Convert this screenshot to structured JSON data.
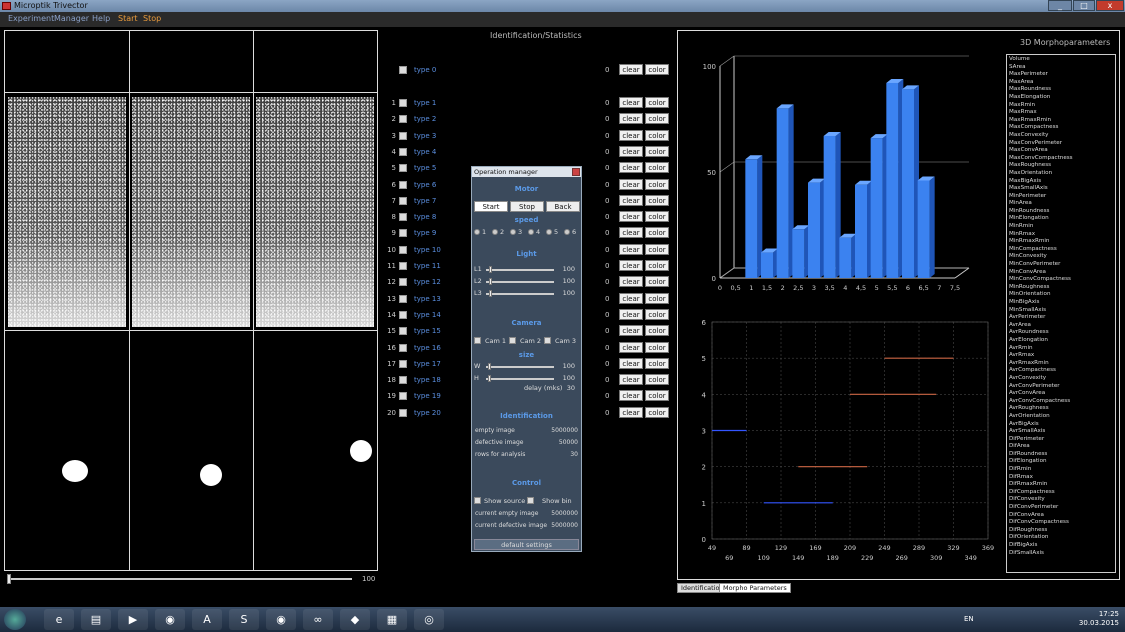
{
  "app": {
    "title": "Microptik Trivector",
    "menu": [
      {
        "label": "Experiment",
        "accent": false
      },
      {
        "label": "Manager",
        "accent": false
      },
      {
        "label": "Help",
        "accent": false
      },
      {
        "label": "Start",
        "accent": true
      },
      {
        "label": "Stop",
        "accent": true
      }
    ]
  },
  "window_buttons": [
    "_",
    "□",
    "x"
  ],
  "left": {
    "slider_value": "100"
  },
  "identification": {
    "title": "Identification/Statistics",
    "type0": {
      "label": "type 0",
      "count": "0"
    },
    "clear_label": "clear",
    "color_label": "color",
    "types": [
      {
        "num": "1",
        "label": "type 1",
        "count": "0"
      },
      {
        "num": "2",
        "label": "type 2",
        "count": "0"
      },
      {
        "num": "3",
        "label": "type 3",
        "count": "0"
      },
      {
        "num": "4",
        "label": "type 4",
        "count": "0"
      },
      {
        "num": "5",
        "label": "type 5",
        "count": "0"
      },
      {
        "num": "6",
        "label": "type 6",
        "count": "0"
      },
      {
        "num": "7",
        "label": "type 7",
        "count": "0"
      },
      {
        "num": "8",
        "label": "type 8",
        "count": "0"
      },
      {
        "num": "9",
        "label": "type 9",
        "count": "0"
      },
      {
        "num": "10",
        "label": "type 10",
        "count": "0"
      },
      {
        "num": "11",
        "label": "type 11",
        "count": "0"
      },
      {
        "num": "12",
        "label": "type 12",
        "count": "0"
      },
      {
        "num": "13",
        "label": "type 13",
        "count": "0"
      },
      {
        "num": "14",
        "label": "type 14",
        "count": "0"
      },
      {
        "num": "15",
        "label": "type 15",
        "count": "0"
      },
      {
        "num": "16",
        "label": "type 16",
        "count": "0"
      },
      {
        "num": "17",
        "label": "type 17",
        "count": "0"
      },
      {
        "num": "18",
        "label": "type 18",
        "count": "0"
      },
      {
        "num": "19",
        "label": "type 19",
        "count": "0"
      },
      {
        "num": "20",
        "label": "type 20",
        "count": "0"
      }
    ]
  },
  "opmanager": {
    "title": "Operation manager",
    "motor": "Motor",
    "start": "Start",
    "stop": "Stop",
    "back": "Back",
    "speed": "speed",
    "speeds": [
      "1",
      "2",
      "3",
      "4",
      "5",
      "6"
    ],
    "light": "Light",
    "lights": [
      {
        "l": "L1",
        "v": "100"
      },
      {
        "l": "L2",
        "v": "100"
      },
      {
        "l": "L3",
        "v": "100"
      }
    ],
    "camera": "Camera",
    "cams": [
      "Cam 1",
      "Cam 2",
      "Cam 3"
    ],
    "size": "size",
    "sizes": [
      {
        "l": "W",
        "v": "100"
      },
      {
        "l": "H",
        "v": "100"
      }
    ],
    "delay_label": "delay (mks)",
    "delay": "30",
    "ident": "Identification",
    "ident_kv": [
      {
        "k": "empty image",
        "v": "5000000"
      },
      {
        "k": "defective image",
        "v": "50000"
      },
      {
        "k": "rows for analysis",
        "v": "30"
      }
    ],
    "control": "Control",
    "show_source": "Show source",
    "show_bin": "Show bin",
    "control_kv": [
      {
        "k": "current empty image",
        "v": "5000000"
      },
      {
        "k": "current defective image",
        "v": "5000000"
      }
    ],
    "default": "default settings"
  },
  "morpho": {
    "title": "3D Morphoparameters",
    "params": [
      "Volume",
      "SArea",
      "MaxPerimeter",
      "MaxArea",
      "MaxRoundness",
      "MaxElongation",
      "MaxRmin",
      "MaxRmax",
      "MaxRmaxRmin",
      "MaxCompactness",
      "MaxConvexity",
      "MaxConvPerimeter",
      "MaxConvArea",
      "MaxConvCompactness",
      "MaxRoughness",
      "MaxOrientation",
      "MaxBigAxis",
      "MaxSmallAxis",
      "MinPerimeter",
      "MinArea",
      "MinRoundness",
      "MinElongation",
      "MinRmin",
      "MinRmax",
      "MinRmaxRmin",
      "MinCompactness",
      "MinConvexity",
      "MinConvPerimeter",
      "MinConvArea",
      "MinConvCompactness",
      "MinRoughness",
      "MinOrientation",
      "MinBigAxis",
      "MinSmallAxis",
      "AvrPerimeter",
      "AvrArea",
      "AvrRoundness",
      "AvrElongation",
      "AvrRmin",
      "AvrRmax",
      "AvrRmaxRmin",
      "AvrCompactness",
      "AvrConvexity",
      "AvrConvPerimeter",
      "AvrConvArea",
      "AvrConvCompactness",
      "AvrRoughness",
      "AvrOrientation",
      "AvrBigAxis",
      "AvrSmallAxis",
      "DifPerimeter",
      "DifArea",
      "DifRoundness",
      "DifElongation",
      "DifRmin",
      "DifRmax",
      "DifRmaxRmin",
      "DifCompactness",
      "DifConvexity",
      "DifConvPerimeter",
      "DifConvArea",
      "DifConvCompactness",
      "DifRoughness",
      "DifOrientation",
      "DifBigAxis",
      "DifSmallAxis"
    ],
    "tabs": [
      "Identification",
      "Morpho Parameters"
    ]
  },
  "chart_data": [
    {
      "type": "bar",
      "x": [
        1,
        1.5,
        2,
        2.5,
        3,
        3.5,
        4,
        4.5,
        5,
        5.5,
        6,
        6.5
      ],
      "values": [
        56,
        12,
        80,
        23,
        45,
        67,
        19,
        44,
        66,
        92,
        89,
        46
      ],
      "xticks": [
        "0",
        "0,5",
        "1",
        "1,5",
        "2",
        "2,5",
        "3",
        "3,5",
        "4",
        "4,5",
        "5",
        "5,5",
        "6",
        "6,5",
        "7",
        "7,5"
      ],
      "yticks": [
        "0",
        "50",
        "100"
      ],
      "ylim": [
        0,
        100
      ],
      "color": "#3b82f0"
    },
    {
      "type": "line",
      "yticks": [
        "0",
        "1",
        "2",
        "3",
        "4",
        "5",
        "6"
      ],
      "xticks_top": [
        "49",
        "89",
        "129",
        "169",
        "209",
        "249",
        "289",
        "329",
        "369"
      ],
      "xticks_bottom": [
        "69",
        "109",
        "149",
        "189",
        "229",
        "269",
        "309",
        "349"
      ],
      "segments": [
        {
          "x0": 49,
          "x1": 89,
          "y": 3,
          "color": "#3355ff"
        },
        {
          "x0": 109,
          "x1": 189,
          "y": 1,
          "color": "#3355ff"
        },
        {
          "x0": 149,
          "x1": 229,
          "y": 2,
          "color": "#cc6644"
        },
        {
          "x0": 209,
          "x1": 309,
          "y": 4,
          "color": "#cc6644"
        },
        {
          "x0": 249,
          "x1": 329,
          "y": 5,
          "color": "#cc6644"
        }
      ]
    }
  ],
  "taskbar": {
    "lang": "EN",
    "time": "17:25",
    "date": "30.03.2015",
    "apps": [
      {
        "icon": "ie-icon",
        "glyph": "e"
      },
      {
        "icon": "folder-icon",
        "glyph": "▤"
      },
      {
        "icon": "media-icon",
        "glyph": "▶"
      },
      {
        "icon": "chrome-icon",
        "glyph": "◉"
      },
      {
        "icon": "app-a-icon",
        "glyph": "A"
      },
      {
        "icon": "skype-icon",
        "glyph": "S"
      },
      {
        "icon": "chrome2-icon",
        "glyph": "◉"
      },
      {
        "icon": "link-icon",
        "glyph": "∞"
      },
      {
        "icon": "pdf-icon",
        "glyph": "◆"
      },
      {
        "icon": "trivector-icon",
        "glyph": "▦"
      },
      {
        "icon": "tool-icon",
        "glyph": "◎"
      }
    ]
  }
}
